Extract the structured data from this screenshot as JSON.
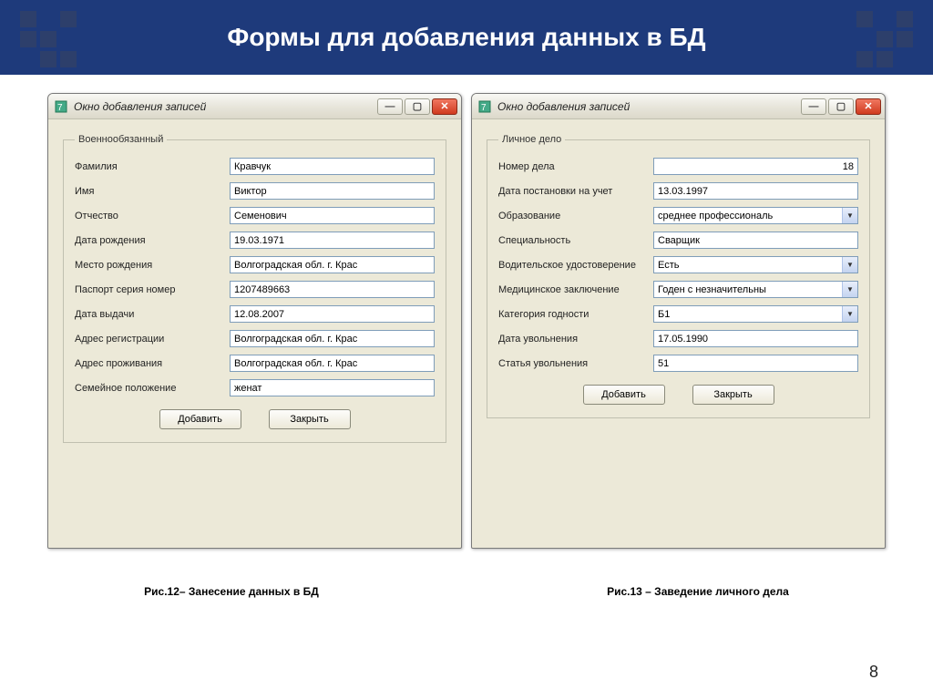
{
  "slide": {
    "title": "Формы для добавления данных в БД",
    "page_number": "8"
  },
  "window_left": {
    "title": "Окно добавления записей",
    "group_legend": "Военнообязанный",
    "fields": [
      {
        "label": "Фамилия",
        "value": "Кравчук",
        "type": "text"
      },
      {
        "label": "Имя",
        "value": "Виктор",
        "type": "text"
      },
      {
        "label": "Отчество",
        "value": "Семенович",
        "type": "text"
      },
      {
        "label": "Дата рождения",
        "value": "19.03.1971",
        "type": "text"
      },
      {
        "label": "Место рождения",
        "value": "Волгоградская обл. г. Крас",
        "type": "text"
      },
      {
        "label": "Паспорт серия номер",
        "value": "1207489663",
        "type": "text"
      },
      {
        "label": "Дата выдачи",
        "value": "12.08.2007",
        "type": "text"
      },
      {
        "label": "Адрес регистрации",
        "value": "Волгоградская обл. г. Крас",
        "type": "text"
      },
      {
        "label": "Адрес проживания",
        "value": "Волгоградская обл. г. Крас",
        "type": "text"
      },
      {
        "label": "Семейное положение",
        "value": "женат",
        "type": "text"
      }
    ],
    "buttons": {
      "add": "Добавить",
      "close": "Закрыть"
    }
  },
  "window_right": {
    "title": "Окно добавления записей",
    "group_legend": "Личное дело",
    "fields": [
      {
        "label": "Номер дела",
        "value": "18",
        "type": "text-right"
      },
      {
        "label": "Дата постановки на учет",
        "value": "13.03.1997",
        "type": "text"
      },
      {
        "label": "Образование",
        "value": "среднее профессиональ",
        "type": "dropdown"
      },
      {
        "label": "Специальность",
        "value": "Сварщик",
        "type": "text"
      },
      {
        "label": "Водительское удостоверение",
        "value": "Есть",
        "type": "dropdown"
      },
      {
        "label": "Медицинское заключение",
        "value": "Годен с незначительны",
        "type": "dropdown"
      },
      {
        "label": "Категория годности",
        "value": "Б1",
        "type": "dropdown"
      },
      {
        "label": "Дата увольнения",
        "value": "17.05.1990",
        "type": "text"
      },
      {
        "label": "Статья увольнения",
        "value": "51",
        "type": "text"
      }
    ],
    "buttons": {
      "add": "Добавить",
      "close": "Закрыть"
    }
  },
  "captions": {
    "left": "Рис.12– Занесение данных в БД",
    "right": "Рис.13 – Заведение личного дела"
  }
}
